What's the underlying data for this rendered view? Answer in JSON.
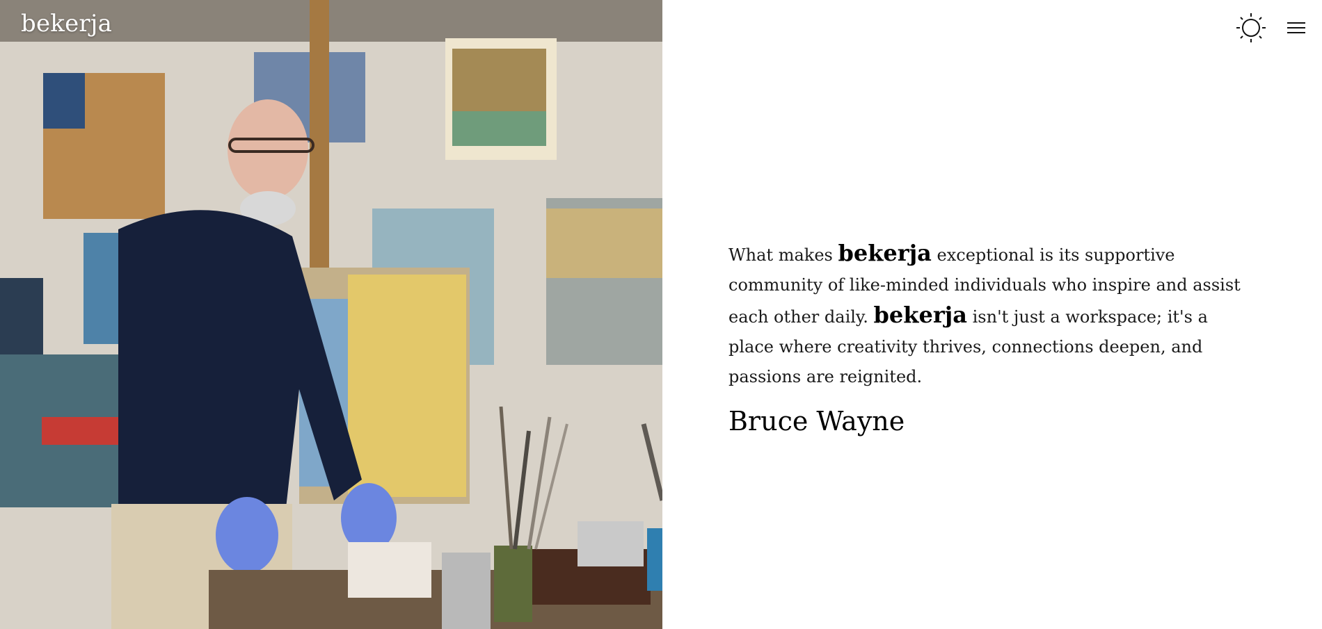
{
  "site": {
    "logo": "bekerja"
  },
  "header": {
    "theme_toggle_icon": "sun-icon",
    "menu_icon": "hamburger-menu-icon"
  },
  "hero_image": {
    "alt": "Painter in a studio with paintings and brushes"
  },
  "testimonial": {
    "part1": "What makes ",
    "brand1": "bekerja",
    "part2": " exceptional is its supportive community of like-minded individuals who inspire and assist each other daily. ",
    "brand2": "bekerja",
    "part3": " isn't just a workspace; it's a place where creativity thrives, connections deepen, and passions are reignited.",
    "author": "Bruce Wayne"
  },
  "colors": {
    "background": "#ffffff",
    "text": "#111111",
    "logo": "#ffffff"
  }
}
